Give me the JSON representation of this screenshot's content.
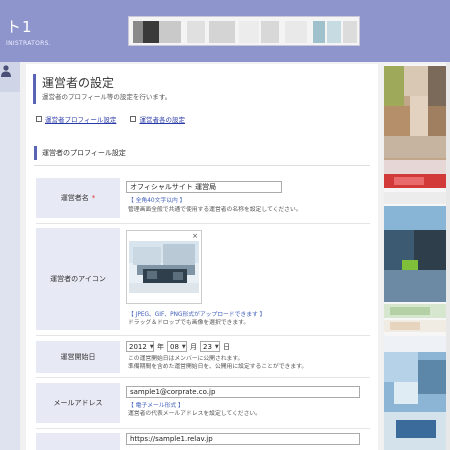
{
  "header": {
    "site_title": "ト1",
    "site_subtitle": "INISTRATORS."
  },
  "page": {
    "title": "運営者の設定",
    "description": "運営者のプロフィール等の設定を行います。",
    "links": [
      {
        "label": "運営者プロフィール設定"
      },
      {
        "label": "運営者各の設定"
      }
    ]
  },
  "section": {
    "title": "運営者のプロフィール設定"
  },
  "fields": {
    "operator_name": {
      "label": "運営者名",
      "required_mark": "*",
      "value": "オフィシャルサイト 運営局",
      "note_format": "【 全角40文字以内 】",
      "note_desc": "管理画面全般で共通で使用する運営者の名称を設定してください。"
    },
    "operator_icon": {
      "label": "運営者のアイコン",
      "close": "×",
      "note_format": "【 JPEG、GIF、PNG形式がアップロードできます 】",
      "note_desc": "ドラッグ＆ドロップでも画像を選択できます。"
    },
    "start_date": {
      "label": "運営開始日",
      "year": "2012",
      "year_unit": "年",
      "month": "08",
      "month_unit": "月",
      "day": "23",
      "day_unit": "日",
      "note1": "この運営開始日はメンバーに公開されます。",
      "note2": "準備期間を含めた運営開始日を、公開用に設定することができます。"
    },
    "email": {
      "label": "メールアドレス",
      "value": "sample1@corprate.co.jp",
      "note_format": "【 電子メール形式 】",
      "note_desc": "運営者の代表メールアドレスを設定してください。"
    },
    "url": {
      "value": "https://sample1.relav.jp"
    }
  },
  "colors": {
    "header_bg": "#8d95cc",
    "accent": "#5a64b4",
    "label_bg": "#e7e9f4",
    "link": "#2a3aa8",
    "required": "#dd3333"
  },
  "icons": [
    "user-icon",
    "external-link-icon",
    "close-icon",
    "chevron-down-icon"
  ]
}
